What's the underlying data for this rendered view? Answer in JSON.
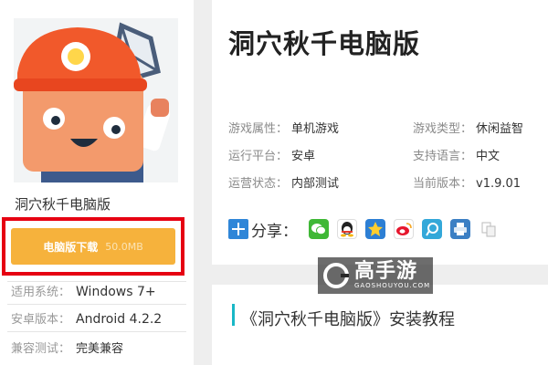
{
  "sidebar": {
    "game_name": "洞穴秋千电脑版",
    "download": {
      "label": "电脑版下载",
      "size": "50.0MB"
    },
    "specs": [
      {
        "key": "适用系统：",
        "value": "Windows 7+"
      },
      {
        "key": "安卓版本：",
        "value": "Android 4.2.2"
      },
      {
        "key": "兼容测试：",
        "value": "完美兼容"
      }
    ]
  },
  "detail": {
    "title": "洞穴秋千电脑版",
    "attributes": [
      {
        "key": "游戏属性：",
        "value": "单机游戏"
      },
      {
        "key": "游戏类型：",
        "value": "休闲益智"
      },
      {
        "key": "运行平台：",
        "value": "安卓"
      },
      {
        "key": "支持语言：",
        "value": "中文"
      },
      {
        "key": "运营状态：",
        "value": "内部测试"
      },
      {
        "key": "当前版本：",
        "value": "v1.9.01"
      }
    ],
    "share_label": "分享：",
    "share_icons": [
      "wechat-icon",
      "qq-icon",
      "qzone-icon",
      "weibo-icon",
      "tencent-weibo-icon",
      "print-icon",
      "copy-icon"
    ]
  },
  "watermark": {
    "main": "高手游",
    "sub": "GAOSHOUYOU.COM"
  },
  "section": {
    "heading": "《洞穴秋千电脑版》安装教程"
  },
  "colors": {
    "download": "#f6b23c",
    "highlight": "#e60012",
    "accent": "#19b7c6"
  }
}
